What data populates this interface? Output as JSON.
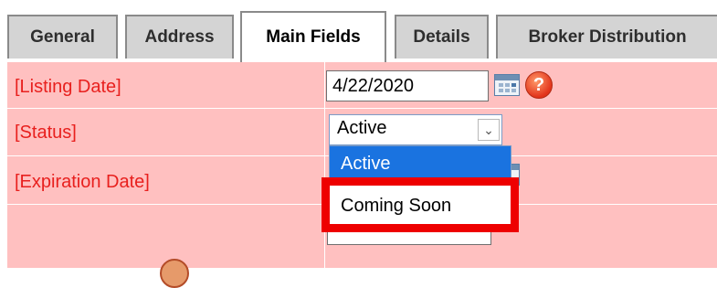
{
  "tabs": [
    {
      "label": "General",
      "active": false
    },
    {
      "label": "Address",
      "active": false
    },
    {
      "label": "Main Fields",
      "active": true
    },
    {
      "label": "Details",
      "active": false
    },
    {
      "label": "Broker Distribution",
      "active": false
    }
  ],
  "fields": {
    "listing_date": {
      "label": "[Listing Date]",
      "value": "4/22/2020"
    },
    "status": {
      "label": "[Status]",
      "value": "Active"
    },
    "expiration_date": {
      "label": "[Expiration Date]"
    }
  },
  "status_options": [
    "Active",
    "Coming Soon"
  ],
  "help_icon_glyph": "?",
  "dropdown_arrow_glyph": "⌄",
  "colors": {
    "form_bg": "#ffc0c0",
    "label": "#e8201e",
    "highlight": "#ee0000",
    "selected_option": "#1a73e0"
  }
}
